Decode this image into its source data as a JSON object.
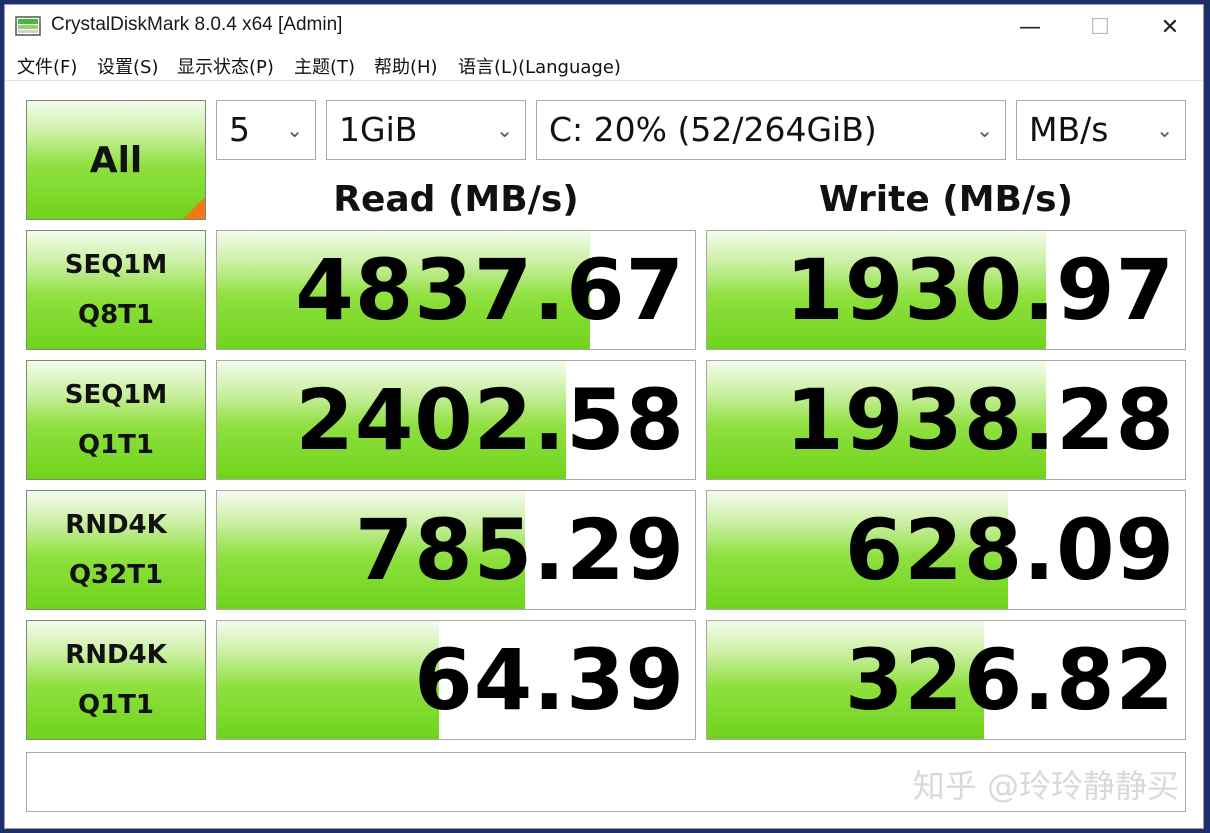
{
  "window": {
    "title": "CrystalDiskMark 8.0.4 x64 [Admin]",
    "controls": {
      "minimize": "—",
      "maximize": "☐",
      "close": "✕"
    }
  },
  "menu": {
    "items": [
      {
        "label": "文件(F)"
      },
      {
        "label": "设置(S)"
      },
      {
        "label": "显示状态(P)"
      },
      {
        "label": "主题(T)"
      },
      {
        "label": "帮助(H)"
      },
      {
        "label": "语言(L)(Language)"
      }
    ]
  },
  "toolbar": {
    "all_label": "All",
    "count": "5",
    "size": "1GiB",
    "drive": "C: 20% (52/264GiB)",
    "unit": "MB/s"
  },
  "headers": {
    "read": "Read (MB/s)",
    "write": "Write (MB/s)"
  },
  "tests": [
    {
      "line1": "SEQ1M",
      "line2": "Q8T1",
      "read": "4837.67",
      "write": "1930.97",
      "read_fill": 0.78,
      "write_fill": 0.71
    },
    {
      "line1": "SEQ1M",
      "line2": "Q1T1",
      "read": "2402.58",
      "write": "1938.28",
      "read_fill": 0.73,
      "write_fill": 0.71
    },
    {
      "line1": "RND4K",
      "line2": "Q32T1",
      "read": "785.29",
      "write": "628.09",
      "read_fill": 0.645,
      "write_fill": 0.63
    },
    {
      "line1": "RND4K",
      "line2": "Q1T1",
      "read": "64.39",
      "write": "326.82",
      "read_fill": 0.465,
      "write_fill": 0.58
    }
  ],
  "watermark": "知乎 @玲玲静静买",
  "colors": {
    "accent_green": "#6fd41a",
    "corner_orange": "#f07a18"
  },
  "icons": {
    "app": "crystaldiskmark-disk-icon",
    "dropdown": "chevron-down-icon"
  }
}
